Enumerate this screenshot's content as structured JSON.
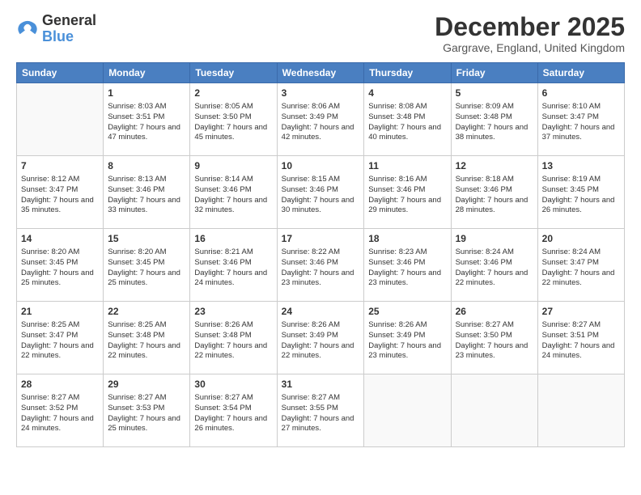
{
  "logo": {
    "line1": "General",
    "line2": "Blue"
  },
  "title": "December 2025",
  "subtitle": "Gargrave, England, United Kingdom",
  "days_header": [
    "Sunday",
    "Monday",
    "Tuesday",
    "Wednesday",
    "Thursday",
    "Friday",
    "Saturday"
  ],
  "weeks": [
    [
      {
        "day": "",
        "sunrise": "",
        "sunset": "",
        "daylight": ""
      },
      {
        "day": "1",
        "sunrise": "Sunrise: 8:03 AM",
        "sunset": "Sunset: 3:51 PM",
        "daylight": "Daylight: 7 hours and 47 minutes."
      },
      {
        "day": "2",
        "sunrise": "Sunrise: 8:05 AM",
        "sunset": "Sunset: 3:50 PM",
        "daylight": "Daylight: 7 hours and 45 minutes."
      },
      {
        "day": "3",
        "sunrise": "Sunrise: 8:06 AM",
        "sunset": "Sunset: 3:49 PM",
        "daylight": "Daylight: 7 hours and 42 minutes."
      },
      {
        "day": "4",
        "sunrise": "Sunrise: 8:08 AM",
        "sunset": "Sunset: 3:48 PM",
        "daylight": "Daylight: 7 hours and 40 minutes."
      },
      {
        "day": "5",
        "sunrise": "Sunrise: 8:09 AM",
        "sunset": "Sunset: 3:48 PM",
        "daylight": "Daylight: 7 hours and 38 minutes."
      },
      {
        "day": "6",
        "sunrise": "Sunrise: 8:10 AM",
        "sunset": "Sunset: 3:47 PM",
        "daylight": "Daylight: 7 hours and 37 minutes."
      }
    ],
    [
      {
        "day": "7",
        "sunrise": "Sunrise: 8:12 AM",
        "sunset": "Sunset: 3:47 PM",
        "daylight": "Daylight: 7 hours and 35 minutes."
      },
      {
        "day": "8",
        "sunrise": "Sunrise: 8:13 AM",
        "sunset": "Sunset: 3:46 PM",
        "daylight": "Daylight: 7 hours and 33 minutes."
      },
      {
        "day": "9",
        "sunrise": "Sunrise: 8:14 AM",
        "sunset": "Sunset: 3:46 PM",
        "daylight": "Daylight: 7 hours and 32 minutes."
      },
      {
        "day": "10",
        "sunrise": "Sunrise: 8:15 AM",
        "sunset": "Sunset: 3:46 PM",
        "daylight": "Daylight: 7 hours and 30 minutes."
      },
      {
        "day": "11",
        "sunrise": "Sunrise: 8:16 AM",
        "sunset": "Sunset: 3:46 PM",
        "daylight": "Daylight: 7 hours and 29 minutes."
      },
      {
        "day": "12",
        "sunrise": "Sunrise: 8:18 AM",
        "sunset": "Sunset: 3:46 PM",
        "daylight": "Daylight: 7 hours and 28 minutes."
      },
      {
        "day": "13",
        "sunrise": "Sunrise: 8:19 AM",
        "sunset": "Sunset: 3:45 PM",
        "daylight": "Daylight: 7 hours and 26 minutes."
      }
    ],
    [
      {
        "day": "14",
        "sunrise": "Sunrise: 8:20 AM",
        "sunset": "Sunset: 3:45 PM",
        "daylight": "Daylight: 7 hours and 25 minutes."
      },
      {
        "day": "15",
        "sunrise": "Sunrise: 8:20 AM",
        "sunset": "Sunset: 3:45 PM",
        "daylight": "Daylight: 7 hours and 25 minutes."
      },
      {
        "day": "16",
        "sunrise": "Sunrise: 8:21 AM",
        "sunset": "Sunset: 3:46 PM",
        "daylight": "Daylight: 7 hours and 24 minutes."
      },
      {
        "day": "17",
        "sunrise": "Sunrise: 8:22 AM",
        "sunset": "Sunset: 3:46 PM",
        "daylight": "Daylight: 7 hours and 23 minutes."
      },
      {
        "day": "18",
        "sunrise": "Sunrise: 8:23 AM",
        "sunset": "Sunset: 3:46 PM",
        "daylight": "Daylight: 7 hours and 23 minutes."
      },
      {
        "day": "19",
        "sunrise": "Sunrise: 8:24 AM",
        "sunset": "Sunset: 3:46 PM",
        "daylight": "Daylight: 7 hours and 22 minutes."
      },
      {
        "day": "20",
        "sunrise": "Sunrise: 8:24 AM",
        "sunset": "Sunset: 3:47 PM",
        "daylight": "Daylight: 7 hours and 22 minutes."
      }
    ],
    [
      {
        "day": "21",
        "sunrise": "Sunrise: 8:25 AM",
        "sunset": "Sunset: 3:47 PM",
        "daylight": "Daylight: 7 hours and 22 minutes."
      },
      {
        "day": "22",
        "sunrise": "Sunrise: 8:25 AM",
        "sunset": "Sunset: 3:48 PM",
        "daylight": "Daylight: 7 hours and 22 minutes."
      },
      {
        "day": "23",
        "sunrise": "Sunrise: 8:26 AM",
        "sunset": "Sunset: 3:48 PM",
        "daylight": "Daylight: 7 hours and 22 minutes."
      },
      {
        "day": "24",
        "sunrise": "Sunrise: 8:26 AM",
        "sunset": "Sunset: 3:49 PM",
        "daylight": "Daylight: 7 hours and 22 minutes."
      },
      {
        "day": "25",
        "sunrise": "Sunrise: 8:26 AM",
        "sunset": "Sunset: 3:49 PM",
        "daylight": "Daylight: 7 hours and 23 minutes."
      },
      {
        "day": "26",
        "sunrise": "Sunrise: 8:27 AM",
        "sunset": "Sunset: 3:50 PM",
        "daylight": "Daylight: 7 hours and 23 minutes."
      },
      {
        "day": "27",
        "sunrise": "Sunrise: 8:27 AM",
        "sunset": "Sunset: 3:51 PM",
        "daylight": "Daylight: 7 hours and 24 minutes."
      }
    ],
    [
      {
        "day": "28",
        "sunrise": "Sunrise: 8:27 AM",
        "sunset": "Sunset: 3:52 PM",
        "daylight": "Daylight: 7 hours and 24 minutes."
      },
      {
        "day": "29",
        "sunrise": "Sunrise: 8:27 AM",
        "sunset": "Sunset: 3:53 PM",
        "daylight": "Daylight: 7 hours and 25 minutes."
      },
      {
        "day": "30",
        "sunrise": "Sunrise: 8:27 AM",
        "sunset": "Sunset: 3:54 PM",
        "daylight": "Daylight: 7 hours and 26 minutes."
      },
      {
        "day": "31",
        "sunrise": "Sunrise: 8:27 AM",
        "sunset": "Sunset: 3:55 PM",
        "daylight": "Daylight: 7 hours and 27 minutes."
      },
      {
        "day": "",
        "sunrise": "",
        "sunset": "",
        "daylight": ""
      },
      {
        "day": "",
        "sunrise": "",
        "sunset": "",
        "daylight": ""
      },
      {
        "day": "",
        "sunrise": "",
        "sunset": "",
        "daylight": ""
      }
    ]
  ]
}
